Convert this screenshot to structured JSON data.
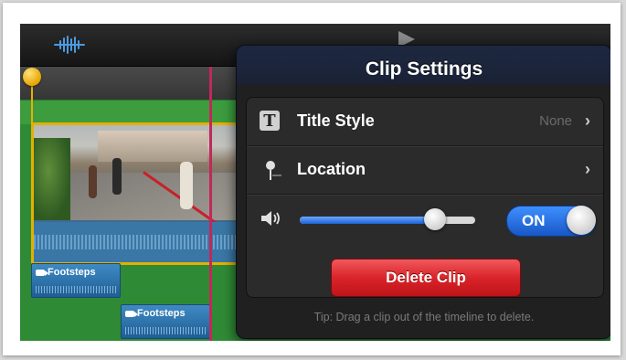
{
  "popover": {
    "title": "Clip Settings",
    "rows": [
      {
        "label": "Title Style",
        "value": "None",
        "icon": "title-t-icon"
      },
      {
        "label": "Location",
        "value": "",
        "icon": "location-pin-icon"
      }
    ],
    "volume": {
      "level": 0.77,
      "icon": "speaker-icon"
    },
    "toggle_label": "ON",
    "delete_label": "Delete Clip",
    "tip": "Tip: Drag a clip out of the timeline to delete."
  },
  "timeline": {
    "audio_clips": [
      {
        "label": "Footsteps"
      },
      {
        "label": "Footsteps"
      }
    ]
  },
  "colors": {
    "accent_blue": "#1c63d6",
    "delete_red": "#d9242a",
    "playhead": "#c2285a",
    "clip_border": "#e4b000"
  }
}
